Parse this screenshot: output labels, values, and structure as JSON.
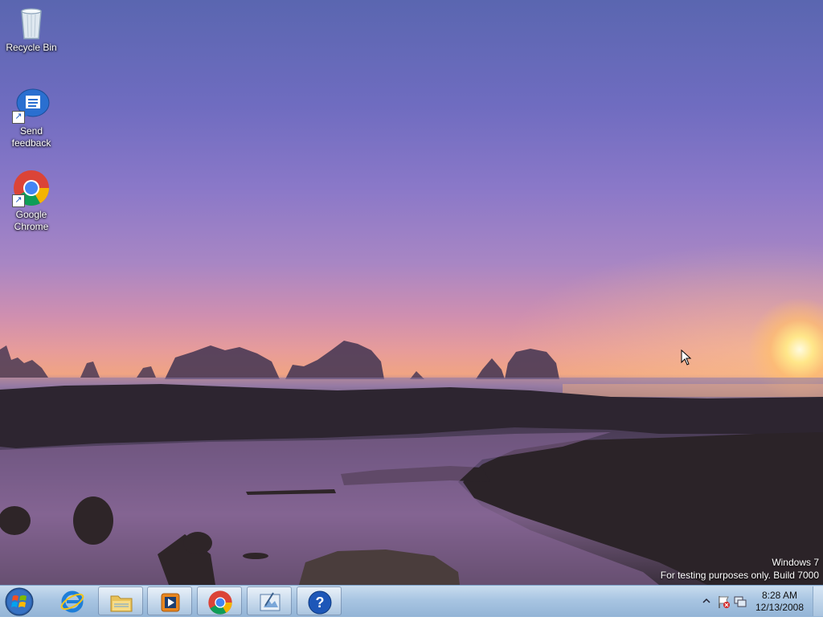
{
  "desktop": {
    "icons": [
      {
        "label": "Recycle Bin",
        "icon": "recycle-bin-icon"
      },
      {
        "label": "Send feedback",
        "icon": "send-feedback-icon"
      },
      {
        "label": "Google Chrome",
        "icon": "chrome-icon"
      }
    ],
    "watermark": {
      "line1": "Windows 7",
      "line2": "For testing purposes only. Build 7000"
    }
  },
  "taskbar": {
    "start_icon": "windows-start-icon",
    "pinned": [
      {
        "name": "Internet Explorer",
        "icon": "internet-explorer-icon"
      },
      {
        "name": "Windows Explorer",
        "icon": "folder-icon"
      },
      {
        "name": "Windows Media Player",
        "icon": "media-player-icon"
      },
      {
        "name": "Google Chrome",
        "icon": "chrome-icon"
      },
      {
        "name": "Paint",
        "icon": "paint-icon"
      },
      {
        "name": "Help",
        "icon": "help-icon"
      }
    ],
    "tray": {
      "time": "8:28 AM",
      "date": "12/13/2008",
      "icons": [
        "show-hidden-icons-chevron",
        "action-center-flag-icon",
        "network-icon"
      ]
    }
  },
  "colors": {
    "taskbar": "#a8c5e2",
    "accent": "#1a55c0"
  }
}
